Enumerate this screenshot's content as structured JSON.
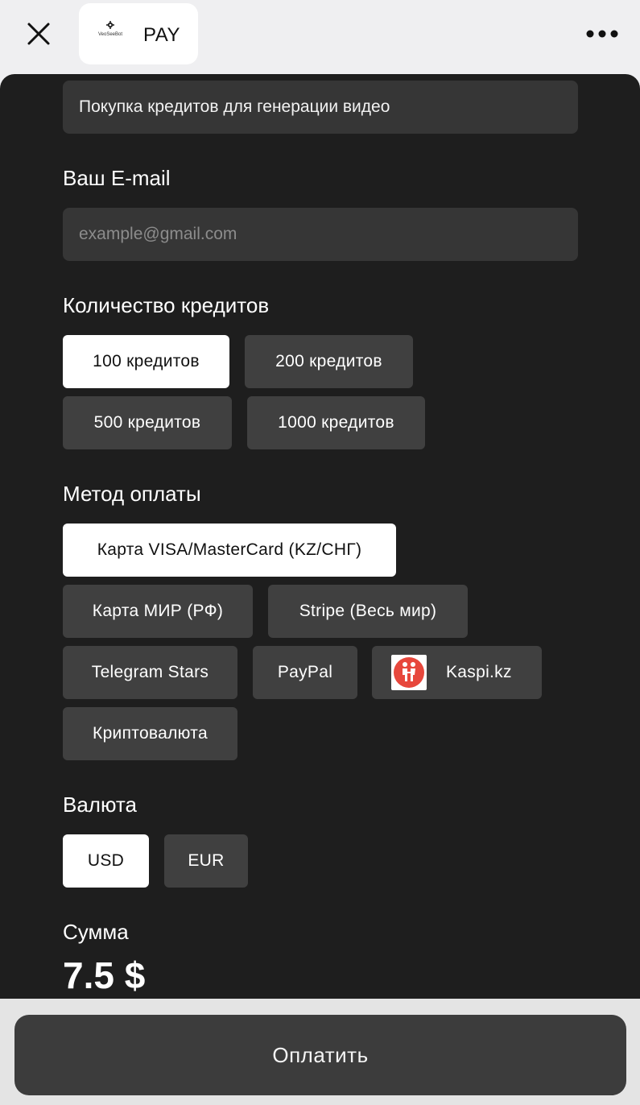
{
  "header": {
    "app_name": "PAY",
    "logo_text": "VeoSeeBot",
    "icons": {
      "close": "close-icon",
      "more": "more-icon",
      "gear": "gear-icon"
    }
  },
  "form": {
    "description": "Покупка кредитов для генерации видео",
    "email_label": "Ваш E-mail",
    "email_placeholder": "example@gmail.com",
    "email_value": "",
    "credits_label": "Количество кредитов",
    "credits_options": [
      "100 кредитов",
      "200 кредитов",
      "500 кредитов",
      "1000 кредитов"
    ],
    "credits_selected": "100 кредитов",
    "payment_label": "Метод оплаты",
    "payment_options": [
      "Карта VISA/MasterCard (KZ/СНГ)",
      "Карта МИР (РФ)",
      "Stripe (Весь мир)",
      "Telegram Stars",
      "PayPal",
      "Kaspi.kz",
      "Криптовалюта"
    ],
    "payment_selected": "Карта VISA/MasterCard (KZ/СНГ)",
    "currency_label": "Валюта",
    "currency_options": [
      "USD",
      "EUR"
    ],
    "currency_selected": "USD",
    "sum_label": "Сумма",
    "sum_value": "7.5 $"
  },
  "footer": {
    "pay_label": "Оплатить"
  },
  "colors": {
    "panel": "#1e1e1e",
    "field": "#363636",
    "option": "#404040",
    "selected": "#ffffff",
    "kaspi_red": "#e7473c"
  }
}
